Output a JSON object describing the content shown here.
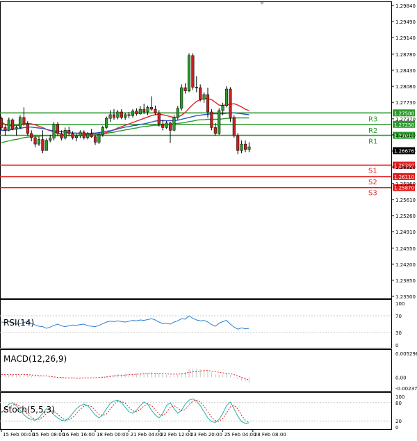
{
  "chart_data": {
    "type": "candlestick",
    "price_axis": {
      "ticks": [
        "1.29840",
        "1.29490",
        "1.29140",
        "1.28780",
        "1.28430",
        "1.28080",
        "1.27730",
        "1.27370",
        "1.27020",
        "1.26670",
        "1.26320",
        "1.25960",
        "1.25610",
        "1.25260",
        "1.24910",
        "1.24550",
        "1.24200",
        "1.23850",
        "1.23500"
      ],
      "range": [
        1.235,
        1.2984
      ],
      "current_price": "1.26676"
    },
    "levels": [
      {
        "label": "R3",
        "value": 1.275,
        "price_label": "1.27500",
        "color": "#2e9a2e"
      },
      {
        "label": "R2",
        "value": 1.2725,
        "price_label": "1.27250",
        "color": "#2e9a2e"
      },
      {
        "label": "R1",
        "value": 1.2701,
        "price_label": "1.27010",
        "color": "#2e9a2e"
      },
      {
        "label": "S1",
        "value": 1.2636,
        "price_label": "1.26360",
        "color": "#e02020"
      },
      {
        "label": "S2",
        "value": 1.2611,
        "price_label": "1.26110",
        "color": "#e02020"
      },
      {
        "label": "S3",
        "value": 1.2587,
        "price_label": "1.25870",
        "color": "#e02020"
      }
    ],
    "candles": [
      [
        1.2738,
        1.2742,
        1.2712,
        1.2718
      ],
      [
        1.2718,
        1.2724,
        1.27,
        1.2712
      ],
      [
        1.2712,
        1.274,
        1.271,
        1.2735
      ],
      [
        1.2735,
        1.2738,
        1.2712,
        1.2715
      ],
      [
        1.2715,
        1.2722,
        1.27,
        1.2718
      ],
      [
        1.2718,
        1.2745,
        1.2715,
        1.274
      ],
      [
        1.274,
        1.2762,
        1.2722,
        1.2726
      ],
      [
        1.2726,
        1.2732,
        1.27,
        1.2705
      ],
      [
        1.2705,
        1.2712,
        1.2688,
        1.2696
      ],
      [
        1.2696,
        1.27,
        1.2675,
        1.2682
      ],
      [
        1.2682,
        1.2698,
        1.2678,
        1.2692
      ],
      [
        1.2692,
        1.2712,
        1.2662,
        1.2668
      ],
      [
        1.2668,
        1.2694,
        1.2668,
        1.269
      ],
      [
        1.269,
        1.2702,
        1.2686,
        1.2695
      ],
      [
        1.2695,
        1.273,
        1.269,
        1.2725
      ],
      [
        1.2725,
        1.273,
        1.27,
        1.2705
      ],
      [
        1.2705,
        1.2712,
        1.269,
        1.2695
      ],
      [
        1.2695,
        1.2718,
        1.2692,
        1.2712
      ],
      [
        1.2712,
        1.272,
        1.27,
        1.2705
      ],
      [
        1.2705,
        1.271,
        1.2692,
        1.2696
      ],
      [
        1.2696,
        1.2705,
        1.2688,
        1.27
      ],
      [
        1.27,
        1.2712,
        1.2695,
        1.2708
      ],
      [
        1.2708,
        1.2712,
        1.2692,
        1.2696
      ],
      [
        1.2696,
        1.2708,
        1.2692,
        1.2704
      ],
      [
        1.2704,
        1.2715,
        1.2696,
        1.2698
      ],
      [
        1.2698,
        1.2702,
        1.268,
        1.2686
      ],
      [
        1.2686,
        1.2706,
        1.2682,
        1.2702
      ],
      [
        1.2702,
        1.2722,
        1.2698,
        1.2718
      ],
      [
        1.2718,
        1.2742,
        1.2715,
        1.2738
      ],
      [
        1.2738,
        1.2756,
        1.273,
        1.2746
      ],
      [
        1.2746,
        1.2758,
        1.2735,
        1.274
      ],
      [
        1.274,
        1.2756,
        1.2736,
        1.2752
      ],
      [
        1.2752,
        1.2758,
        1.2736,
        1.274
      ],
      [
        1.274,
        1.275,
        1.2735,
        1.2746
      ],
      [
        1.2746,
        1.2752,
        1.2738,
        1.2744
      ],
      [
        1.2744,
        1.2758,
        1.274,
        1.2754
      ],
      [
        1.2754,
        1.276,
        1.2744,
        1.2748
      ],
      [
        1.2748,
        1.2765,
        1.2746,
        1.2758
      ],
      [
        1.2758,
        1.277,
        1.2748,
        1.2752
      ],
      [
        1.2752,
        1.2766,
        1.2745,
        1.2762
      ],
      [
        1.2762,
        1.2786,
        1.2755,
        1.2758
      ],
      [
        1.2758,
        1.2766,
        1.2745,
        1.275
      ],
      [
        1.275,
        1.2756,
        1.272,
        1.2726
      ],
      [
        1.2726,
        1.2735,
        1.2712,
        1.2718
      ],
      [
        1.2718,
        1.2732,
        1.2715,
        1.2728
      ],
      [
        1.2728,
        1.273,
        1.2684,
        1.2712
      ],
      [
        1.2712,
        1.2745,
        1.271,
        1.274
      ],
      [
        1.274,
        1.2765,
        1.2735,
        1.276
      ],
      [
        1.276,
        1.2812,
        1.2755,
        1.2805
      ],
      [
        1.2805,
        1.2815,
        1.2792,
        1.2798
      ],
      [
        1.2798,
        1.288,
        1.2795,
        1.2875
      ],
      [
        1.2875,
        1.288,
        1.28,
        1.2806
      ],
      [
        1.2806,
        1.283,
        1.2795,
        1.2805
      ],
      [
        1.2805,
        1.2812,
        1.2775,
        1.278
      ],
      [
        1.278,
        1.2795,
        1.2772,
        1.279
      ],
      [
        1.279,
        1.2805,
        1.274,
        1.2752
      ],
      [
        1.2752,
        1.2758,
        1.2712,
        1.2718
      ],
      [
        1.2718,
        1.2728,
        1.27,
        1.2705
      ],
      [
        1.2705,
        1.276,
        1.2702,
        1.2755
      ],
      [
        1.2755,
        1.2772,
        1.2745,
        1.2766
      ],
      [
        1.2766,
        1.2808,
        1.2762,
        1.2802
      ],
      [
        1.2802,
        1.2806,
        1.273,
        1.274
      ],
      [
        1.274,
        1.2745,
        1.2696,
        1.27
      ],
      [
        1.27,
        1.2706,
        1.266,
        1.2668
      ],
      [
        1.2668,
        1.269,
        1.2662,
        1.2682
      ],
      [
        1.2682,
        1.269,
        1.2664,
        1.267
      ],
      [
        1.267,
        1.2686,
        1.2664,
        1.2676
      ]
    ],
    "moving_averages": [
      {
        "name": "red",
        "color": "#e02020",
        "values": [
          1.273,
          1.2725,
          1.2722,
          1.2722,
          1.2722,
          1.2723,
          1.2726,
          1.2727,
          1.2726,
          1.2724,
          1.2721,
          1.2718,
          1.2714,
          1.2711,
          1.2709,
          1.2706,
          1.2703,
          1.2701,
          1.27,
          1.27,
          1.27,
          1.2701,
          1.2702,
          1.2703,
          1.2704,
          1.2704,
          1.2704,
          1.2705,
          1.2707,
          1.271,
          1.2713,
          1.2717,
          1.272,
          1.2723,
          1.2726,
          1.2729,
          1.2732,
          1.2735,
          1.2738,
          1.2741,
          1.2744,
          1.2746,
          1.2747,
          1.2746,
          1.2744,
          1.2742,
          1.274,
          1.2741,
          1.2745,
          1.2751,
          1.276,
          1.2768,
          1.2775,
          1.2779,
          1.2781,
          1.2781,
          1.2779,
          1.2773,
          1.2767,
          1.2766,
          1.2768,
          1.2769,
          1.277,
          1.2767,
          1.2763,
          1.2758,
          1.2755
        ]
      },
      {
        "name": "blue",
        "color": "#3050c8",
        "values": [
          1.2712,
          1.2712,
          1.2713,
          1.2714,
          1.2715,
          1.2716,
          1.2718,
          1.2719,
          1.2719,
          1.2718,
          1.2717,
          1.2716,
          1.2714,
          1.2712,
          1.2711,
          1.271,
          1.2709,
          1.2708,
          1.2707,
          1.2706,
          1.2706,
          1.2705,
          1.2705,
          1.2705,
          1.2706,
          1.2706,
          1.2707,
          1.2708,
          1.271,
          1.2711,
          1.2713,
          1.2715,
          1.2717,
          1.2719,
          1.272,
          1.2722,
          1.2723,
          1.2725,
          1.2726,
          1.2728,
          1.273,
          1.2732,
          1.2733,
          1.2733,
          1.2733,
          1.2733,
          1.2733,
          1.2734,
          1.2736,
          1.2738,
          1.274,
          1.2742,
          1.2744,
          1.2745,
          1.2746,
          1.2747,
          1.2748,
          1.2748,
          1.2748,
          1.2748,
          1.2749,
          1.275,
          1.275,
          1.2749,
          1.2748,
          1.2747,
          1.2746
        ]
      },
      {
        "name": "green",
        "color": "#2e9a2e",
        "values": [
          1.2685,
          1.2687,
          1.2689,
          1.2691,
          1.2692,
          1.2694,
          1.2696,
          1.2697,
          1.2698,
          1.2699,
          1.2699,
          1.27,
          1.27,
          1.27,
          1.27,
          1.27,
          1.27,
          1.27,
          1.27,
          1.27,
          1.27,
          1.27,
          1.27,
          1.2701,
          1.2701,
          1.2702,
          1.2703,
          1.2704,
          1.2705,
          1.2707,
          1.2708,
          1.271,
          1.2711,
          1.2713,
          1.2714,
          1.2716,
          1.2717,
          1.2719,
          1.272,
          1.2721,
          1.2722,
          1.2723,
          1.2723,
          1.2724,
          1.2724,
          1.2725,
          1.2726,
          1.2727,
          1.2728,
          1.2729,
          1.2731,
          1.2732,
          1.2734,
          1.2735,
          1.2735,
          1.2736,
          1.2736,
          1.2736,
          1.2736,
          1.2737,
          1.2738,
          1.2738,
          1.2739,
          1.2739,
          1.2739,
          1.2739,
          1.2739
        ]
      }
    ],
    "time_labels": [
      "15 Feb 00:00",
      "15 Feb 08:00",
      "16 Feb 16:00",
      "18 Feb 00:00",
      "21 Feb 04:00",
      "22 Feb 12:00",
      "23 Feb 20:00",
      "25 Feb 04:00",
      "28 Feb 08:00"
    ],
    "time_label_bars": [
      0,
      8,
      16,
      25,
      34,
      42,
      50,
      59,
      67
    ],
    "indicators": {
      "rsi": {
        "title": "RSI(14)",
        "range": [
          0,
          100
        ],
        "ticks": [
          "100",
          "70",
          "30",
          "0"
        ],
        "tick_values": [
          100,
          70,
          30,
          0
        ],
        "levels": [
          70,
          30
        ],
        "color": "#2a7fd6",
        "values": [
          55,
          54,
          56,
          52,
          50,
          51,
          54,
          56,
          52,
          48,
          45,
          44,
          40,
          43,
          47,
          50,
          46,
          44,
          46,
          48,
          47,
          49,
          50,
          46,
          45,
          44,
          47,
          51,
          55,
          57,
          56,
          58,
          56,
          55,
          57,
          59,
          58,
          60,
          59,
          61,
          63,
          60,
          55,
          51,
          52,
          50,
          55,
          58,
          63,
          62,
          70,
          64,
          60,
          58,
          59,
          55,
          49,
          45,
          52,
          56,
          59,
          50,
          43,
          38,
          41,
          39,
          40
        ]
      },
      "macd": {
        "title": "MACD(12,26,9)",
        "range": [
          -0.002379,
          0.005296
        ],
        "ticks": [
          "0.005296",
          "0.00",
          "-0.002379"
        ],
        "tick_values": [
          0.005296,
          0.0,
          -0.002379
        ],
        "signal_color": "#e02020",
        "histogram_color": "#c0c0c0",
        "histogram": [
          0.0004,
          0.0005,
          0.0006,
          0.0006,
          0.0005,
          0.0005,
          0.0006,
          0.0005,
          0.0004,
          0.0003,
          0.0002,
          0.0001,
          0.0,
          -0.0001,
          -0.0001,
          -0.0002,
          -0.0003,
          -0.0003,
          -0.0002,
          -0.0002,
          -0.0002,
          -0.0001,
          -0.0001,
          -0.0001,
          0.0,
          0.0,
          0.0001,
          0.0002,
          0.0003,
          0.0005,
          0.0006,
          0.0007,
          0.0007,
          0.0008,
          0.0008,
          0.0008,
          0.0009,
          0.0009,
          0.0009,
          0.001,
          0.0011,
          0.001,
          0.0009,
          0.0007,
          0.0006,
          0.0004,
          0.0004,
          0.0006,
          0.0009,
          0.0012,
          0.0018,
          0.0019,
          0.0019,
          0.0018,
          0.0017,
          0.0015,
          0.0011,
          0.0007,
          0.0005,
          0.0006,
          0.0008,
          0.0005,
          0.0001,
          -0.0004,
          -0.0007,
          -0.0009,
          -0.0011
        ],
        "signal": [
          0.0006,
          0.0006,
          0.0006,
          0.0006,
          0.0006,
          0.0006,
          0.0006,
          0.0006,
          0.0005,
          0.0005,
          0.0004,
          0.0003,
          0.0003,
          0.0002,
          0.0001,
          0.0,
          0.0,
          -0.0001,
          -0.0001,
          -0.0001,
          -0.0002,
          -0.0002,
          -0.0001,
          -0.0001,
          -0.0001,
          -0.0001,
          0.0,
          0.0,
          0.0001,
          0.0002,
          0.0003,
          0.0004,
          0.0004,
          0.0005,
          0.0006,
          0.0006,
          0.0007,
          0.0007,
          0.0008,
          0.0008,
          0.0009,
          0.0009,
          0.0009,
          0.0008,
          0.0008,
          0.0007,
          0.0007,
          0.0007,
          0.0008,
          0.0009,
          0.0011,
          0.0012,
          0.0013,
          0.0014,
          0.0015,
          0.0015,
          0.0014,
          0.0013,
          0.0011,
          0.001,
          0.0009,
          0.0008,
          0.0006,
          0.0003,
          0.0,
          -0.0003,
          -0.0006
        ]
      },
      "stoch": {
        "title": "Stoch(5,5,3)",
        "range": [
          0,
          100
        ],
        "ticks": [
          "100",
          "80",
          "20",
          "0"
        ],
        "tick_values": [
          100,
          80,
          20,
          0
        ],
        "levels": [
          80,
          20
        ],
        "k_color": "#20b2aa",
        "d_color": "#e02020",
        "k": [
          45,
          60,
          75,
          80,
          70,
          55,
          40,
          30,
          25,
          22,
          30,
          45,
          60,
          55,
          40,
          30,
          22,
          20,
          30,
          45,
          60,
          70,
          75,
          70,
          55,
          40,
          30,
          40,
          60,
          78,
          85,
          88,
          80,
          65,
          50,
          45,
          55,
          70,
          82,
          75,
          55,
          40,
          30,
          45,
          70,
          80,
          60,
          45,
          55,
          75,
          88,
          92,
          85,
          70,
          50,
          30,
          18,
          15,
          25,
          45,
          70,
          82,
          60,
          35,
          18,
          12,
          14
        ],
        "d": [
          50,
          52,
          62,
          72,
          75,
          68,
          55,
          42,
          32,
          26,
          26,
          32,
          45,
          53,
          52,
          42,
          31,
          24,
          24,
          32,
          45,
          58,
          68,
          72,
          67,
          55,
          42,
          37,
          43,
          59,
          74,
          84,
          84,
          78,
          65,
          53,
          50,
          57,
          69,
          76,
          71,
          57,
          42,
          38,
          48,
          65,
          70,
          62,
          53,
          58,
          73,
          85,
          88,
          82,
          68,
          50,
          33,
          21,
          19,
          28,
          47,
          66,
          71,
          59,
          38,
          22,
          15
        ]
      }
    }
  }
}
